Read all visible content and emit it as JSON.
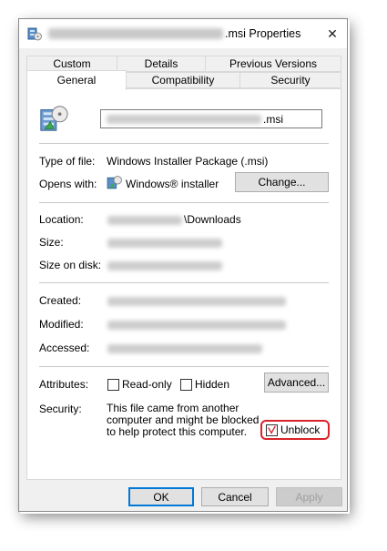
{
  "window": {
    "title_suffix": ".msi Properties",
    "close_glyph": "✕"
  },
  "tabs": {
    "row1": [
      {
        "label": "Custom"
      },
      {
        "label": "Details"
      },
      {
        "label": "Previous Versions"
      }
    ],
    "row2": [
      {
        "label": "General",
        "active": true
      },
      {
        "label": "Compatibility"
      },
      {
        "label": "Security"
      }
    ]
  },
  "general": {
    "file_name_suffix": ".msi",
    "type_label": "Type of file:",
    "type_value": "Windows Installer Package (.msi)",
    "opens_with_label": "Opens with:",
    "opens_with_value": "Windows® installer",
    "change_button": "Change...",
    "location_label": "Location:",
    "location_suffix": "\\Downloads",
    "size_label": "Size:",
    "size_on_disk_label": "Size on disk:",
    "created_label": "Created:",
    "modified_label": "Modified:",
    "accessed_label": "Accessed:",
    "attributes_label": "Attributes:",
    "readonly_label": "Read-only",
    "readonly_checked": false,
    "hidden_label": "Hidden",
    "hidden_checked": false,
    "advanced_button": "Advanced...",
    "security_label": "Security:",
    "security_text": "This file came from another computer and might be blocked to help protect this computer.",
    "unblock_label": "Unblock",
    "unblock_checked": true
  },
  "footer": {
    "ok": "OK",
    "cancel": "Cancel",
    "apply": "Apply"
  },
  "colors": {
    "highlight": "#d9232a",
    "default_button_border": "#0078d7",
    "check_mark": "#d9232a"
  },
  "icons": {
    "title": "msi-package-icon",
    "file": "installer-package-icon",
    "opens_with": "windows-installer-icon",
    "close": "close-icon"
  }
}
